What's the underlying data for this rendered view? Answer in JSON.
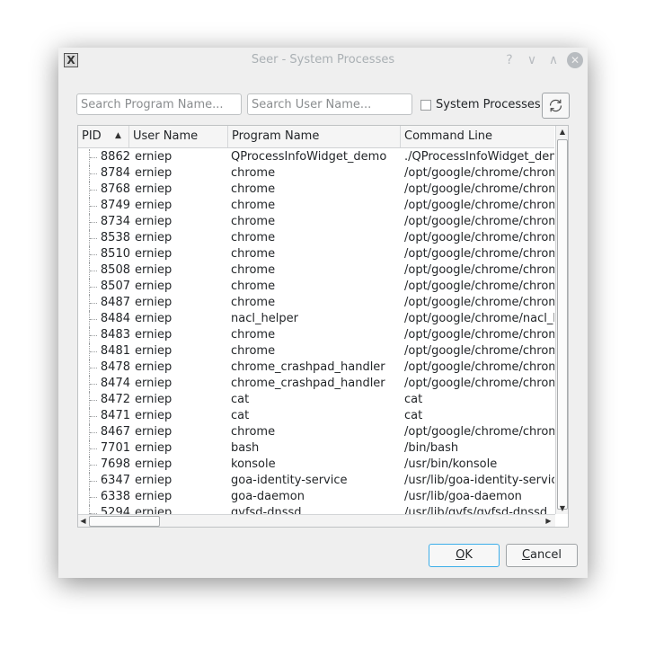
{
  "window": {
    "title": "Seer - System Processes",
    "buttons": {
      "help": "?",
      "minimize": "∨",
      "maximize": "∧",
      "close": "✕"
    }
  },
  "filters": {
    "program_placeholder": "Search Program Name...",
    "user_placeholder": "Search User Name...",
    "system_processes_label": "System Processes",
    "system_processes_checked": false
  },
  "table": {
    "columns": [
      "PID",
      "User Name",
      "Program  Name",
      "Command Line"
    ],
    "sort_column": "PID",
    "sort_order": "ascending",
    "rows": [
      {
        "pid": "8862",
        "user": "erniep",
        "program": "QProcessInfoWidget_demo",
        "command": "./QProcessInfoWidget_demo"
      },
      {
        "pid": "8784",
        "user": "erniep",
        "program": "chrome",
        "command": "/opt/google/chrome/chrome"
      },
      {
        "pid": "8768",
        "user": "erniep",
        "program": "chrome",
        "command": "/opt/google/chrome/chrome"
      },
      {
        "pid": "8749",
        "user": "erniep",
        "program": "chrome",
        "command": "/opt/google/chrome/chrome"
      },
      {
        "pid": "8734",
        "user": "erniep",
        "program": "chrome",
        "command": "/opt/google/chrome/chrome"
      },
      {
        "pid": "8538",
        "user": "erniep",
        "program": "chrome",
        "command": "/opt/google/chrome/chrome"
      },
      {
        "pid": "8510",
        "user": "erniep",
        "program": "chrome",
        "command": "/opt/google/chrome/chrome"
      },
      {
        "pid": "8508",
        "user": "erniep",
        "program": "chrome",
        "command": "/opt/google/chrome/chrome"
      },
      {
        "pid": "8507",
        "user": "erniep",
        "program": "chrome",
        "command": "/opt/google/chrome/chrome"
      },
      {
        "pid": "8487",
        "user": "erniep",
        "program": "chrome",
        "command": "/opt/google/chrome/chrome"
      },
      {
        "pid": "8484",
        "user": "erniep",
        "program": "nacl_helper",
        "command": "/opt/google/chrome/nacl_helper"
      },
      {
        "pid": "8483",
        "user": "erniep",
        "program": "chrome",
        "command": "/opt/google/chrome/chrome"
      },
      {
        "pid": "8481",
        "user": "erniep",
        "program": "chrome",
        "command": "/opt/google/chrome/chrome"
      },
      {
        "pid": "8478",
        "user": "erniep",
        "program": "chrome_crashpad_handler",
        "command": "/opt/google/chrome/chrome"
      },
      {
        "pid": "8474",
        "user": "erniep",
        "program": "chrome_crashpad_handler",
        "command": "/opt/google/chrome/chrome"
      },
      {
        "pid": "8472",
        "user": "erniep",
        "program": "cat",
        "command": "cat"
      },
      {
        "pid": "8471",
        "user": "erniep",
        "program": "cat",
        "command": "cat"
      },
      {
        "pid": "8467",
        "user": "erniep",
        "program": "chrome",
        "command": "/opt/google/chrome/chrome"
      },
      {
        "pid": "7701",
        "user": "erniep",
        "program": "bash",
        "command": "/bin/bash"
      },
      {
        "pid": "7698",
        "user": "erniep",
        "program": "konsole",
        "command": "/usr/bin/konsole"
      },
      {
        "pid": "6347",
        "user": "erniep",
        "program": "goa-identity-service",
        "command": "/usr/lib/goa-identity-service"
      },
      {
        "pid": "6338",
        "user": "erniep",
        "program": "goa-daemon",
        "command": "/usr/lib/goa-daemon"
      },
      {
        "pid": "5294",
        "user": "erniep",
        "program": "gvfsd-dnssd",
        "command": "/usr/lib/gvfs/gvfsd-dnssd"
      }
    ]
  },
  "buttons": {
    "ok_mnemonic": "O",
    "ok_rest": "K",
    "cancel_mnemonic": "C",
    "cancel_rest": "ancel"
  },
  "icons": {
    "refresh": "refresh-icon",
    "sort": "sort-ascending-icon",
    "app": "seer-app-icon"
  }
}
